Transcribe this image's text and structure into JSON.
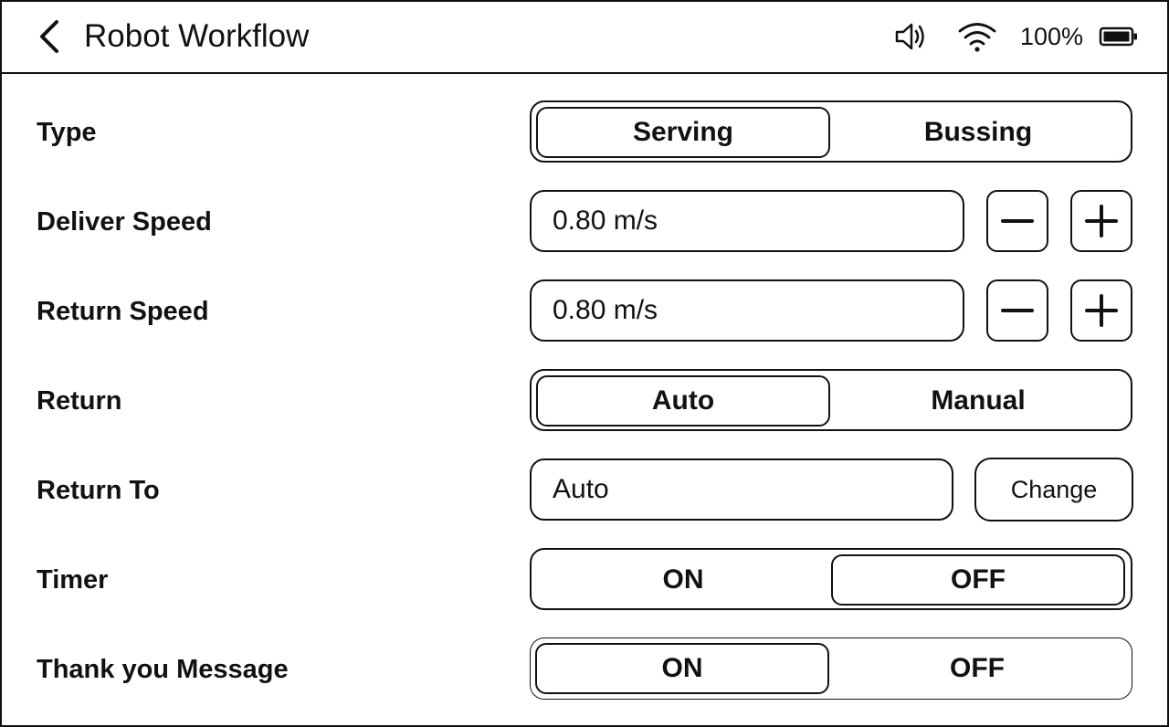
{
  "header": {
    "title": "Robot Workflow",
    "back_icon": "chevron-left-icon",
    "volume_icon": "speaker-icon",
    "wifi_icon": "wifi-icon",
    "battery_text": "100%",
    "battery_icon": "battery-icon",
    "battery_level": 1.0
  },
  "settings": {
    "type": {
      "label": "Type",
      "options": [
        "Serving",
        "Bussing"
      ],
      "selected": "Serving"
    },
    "deliver_speed": {
      "label": "Deliver Speed",
      "value": "0.80 m/s",
      "minus_icon": "minus-icon",
      "plus_icon": "plus-icon"
    },
    "return_speed": {
      "label": "Return Speed",
      "value": "0.80 m/s",
      "minus_icon": "minus-icon",
      "plus_icon": "plus-icon"
    },
    "return": {
      "label": "Return",
      "options": [
        "Auto",
        "Manual"
      ],
      "selected": "Auto"
    },
    "return_to": {
      "label": "Return To",
      "value": "Auto",
      "button": "Change"
    },
    "timer": {
      "label": "Timer",
      "options": [
        "ON",
        "OFF"
      ],
      "selected": "OFF"
    },
    "thank_you": {
      "label": "Thank you Message",
      "options": [
        "ON",
        "OFF"
      ],
      "selected": "ON"
    }
  },
  "colors": {
    "foreground": "#111111",
    "background": "#ffffff"
  }
}
